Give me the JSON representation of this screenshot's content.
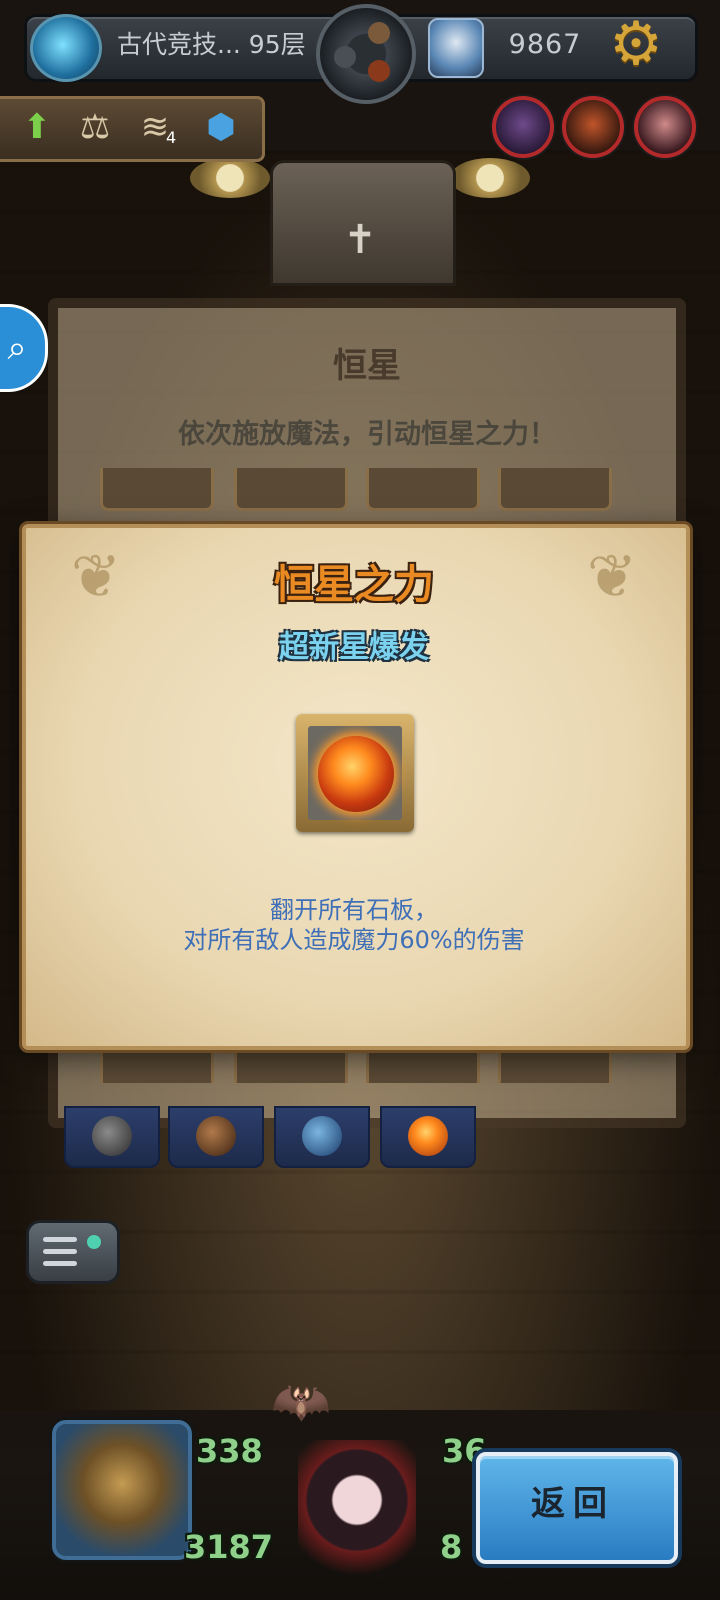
{
  "top_bar": {
    "floor_label": "古代竞技... 95层",
    "gold": "9867",
    "floor_icon": "portal-icon",
    "settings_icon": "gear-icon"
  },
  "buffs": {
    "spring_count": "4",
    "icons": [
      "up-arrow-icon",
      "scale-icon",
      "spring-icon",
      "shell-icon"
    ]
  },
  "background_panel": {
    "title": "恒星",
    "subtitle": "依次施放魔法，引动恒星之力！"
  },
  "modal": {
    "title": "恒星之力",
    "subtitle": "超新星爆发",
    "skill_icon": "sun-icon",
    "description_line1": "翻开所有石板，",
    "description_line2": "对所有敌人造成魔力60%的伤害"
  },
  "hud": {
    "attack": "338",
    "hp": "3187",
    "defense": "36",
    "mp": "8",
    "back_button": "返回"
  },
  "colors": {
    "modal_title": "#e98a22",
    "modal_subtitle": "#7ad2ee",
    "description": "#3f6fb7",
    "back_button": "#2a7cc2"
  }
}
